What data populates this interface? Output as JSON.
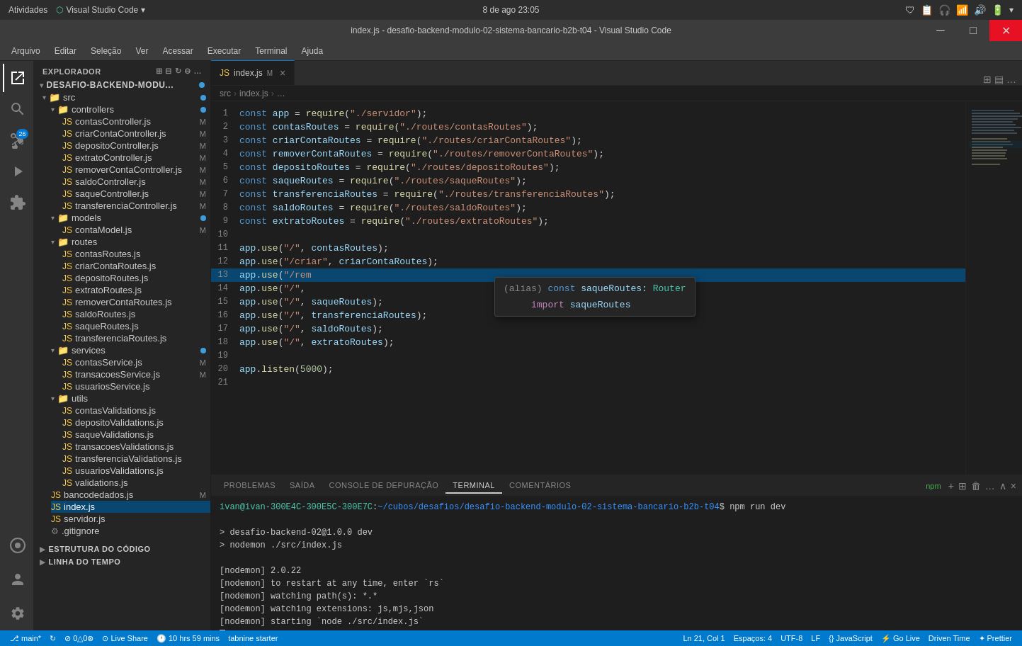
{
  "system_bar": {
    "left_items": [
      "Atividades"
    ],
    "app_title": "Visual Studio Code",
    "datetime": "8 de ago  23:05",
    "icons": [
      "network",
      "sound",
      "battery",
      "settings"
    ]
  },
  "title_bar": {
    "title": "index.js - desafio-backend-modulo-02-sistema-bancario-b2b-t04 - Visual Studio Code",
    "controls": [
      "minimize",
      "maximize",
      "close"
    ]
  },
  "menu_bar": {
    "items": [
      "Arquivo",
      "Editar",
      "Seleção",
      "Ver",
      "Acessar",
      "Executar",
      "Terminal",
      "Ajuda"
    ]
  },
  "activity_bar": {
    "icons": [
      {
        "name": "explorer-icon",
        "symbol": "⬚",
        "active": true
      },
      {
        "name": "search-icon",
        "symbol": "🔍",
        "active": false
      },
      {
        "name": "source-control-icon",
        "symbol": "⎇",
        "active": false,
        "badge": "26"
      },
      {
        "name": "run-debug-icon",
        "symbol": "▷",
        "active": false
      },
      {
        "name": "extensions-icon",
        "symbol": "⊞",
        "active": false
      },
      {
        "name": "remote-icon",
        "symbol": "⊙",
        "active": false
      },
      {
        "name": "accounts-icon",
        "symbol": "👤",
        "active": false
      },
      {
        "name": "settings-icon",
        "symbol": "⚙",
        "active": false
      }
    ]
  },
  "explorer": {
    "title": "EXPLORADOR",
    "project": "DESAFIO-BACKEND-MODU...",
    "tree": {
      "src": {
        "controllers": {
          "files": [
            {
              "name": "contasController.js",
              "modified": "M"
            },
            {
              "name": "criarContaController.js",
              "modified": "M"
            },
            {
              "name": "depositoController.js",
              "modified": "M"
            },
            {
              "name": "extratoController.js",
              "modified": "M"
            },
            {
              "name": "removerContaController.js",
              "modified": "M"
            },
            {
              "name": "saldoController.js",
              "modified": "M"
            },
            {
              "name": "saqueController.js",
              "modified": "M"
            },
            {
              "name": "transferenciaController.js",
              "modified": "M"
            }
          ]
        },
        "models": {
          "files": [
            {
              "name": "contaModel.js",
              "modified": "M"
            }
          ]
        },
        "routes": {
          "files": [
            {
              "name": "contasRoutes.js",
              "modified": ""
            },
            {
              "name": "criarContaRoutes.js",
              "modified": ""
            },
            {
              "name": "depositoRoutes.js",
              "modified": ""
            },
            {
              "name": "extratoRoutes.js",
              "modified": ""
            },
            {
              "name": "removerContaRoutes.js",
              "modified": ""
            },
            {
              "name": "saldoRoutes.js",
              "modified": ""
            },
            {
              "name": "saqueRoutes.js",
              "modified": ""
            },
            {
              "name": "transferenciaRoutes.js",
              "modified": ""
            }
          ]
        },
        "services": {
          "files": [
            {
              "name": "contasService.js",
              "modified": "M"
            },
            {
              "name": "transacoesService.js",
              "modified": "M"
            },
            {
              "name": "usuariosService.js",
              "modified": ""
            }
          ]
        },
        "utils": {
          "files": [
            {
              "name": "contasValidations.js",
              "modified": ""
            },
            {
              "name": "depositoValidations.js",
              "modified": ""
            },
            {
              "name": "saqueValidations.js",
              "modified": ""
            },
            {
              "name": "transacoesValidations.js",
              "modified": ""
            },
            {
              "name": "transferenciaValidations.js",
              "modified": ""
            },
            {
              "name": "usuariosValidations.js",
              "modified": ""
            },
            {
              "name": "validations.js",
              "modified": ""
            }
          ]
        },
        "root_files": [
          {
            "name": "bancodedados.js",
            "modified": "M"
          },
          {
            "name": "index.js",
            "modified": ""
          },
          {
            "name": "servidor.js",
            "modified": ""
          },
          {
            "name": ".gitignore",
            "modified": ""
          }
        ]
      }
    }
  },
  "editor": {
    "tab": {
      "filename": "index.js",
      "modified": "M",
      "close_symbol": "×"
    },
    "breadcrumb": [
      "src",
      ">",
      "index.js",
      ">",
      "..."
    ],
    "lines": [
      {
        "num": 1,
        "content": "const app = require(\"./servidor\");"
      },
      {
        "num": 2,
        "content": "const contasRoutes = require(\"./routes/contasRoutes\");"
      },
      {
        "num": 3,
        "content": "const criarContaRoutes = require(\"./routes/criarContaRoutes\");"
      },
      {
        "num": 4,
        "content": "const removerContaRoutes = require(\"./routes/removerContaRoutes\");"
      },
      {
        "num": 5,
        "content": "const depositoRoutes = require(\"./routes/depositoRoutes\");"
      },
      {
        "num": 6,
        "content": "const saqueRoutes = require(\"./routes/saqueRoutes\");"
      },
      {
        "num": 7,
        "content": "const transferenciaRoutes = require(\"./routes/transferenciaRoutes\");"
      },
      {
        "num": 8,
        "content": "const saldoRoutes = require(\"./routes/saldoRoutes\");"
      },
      {
        "num": 9,
        "content": "const extratoRoutes = require(\"./routes/extratoRoutes\");"
      },
      {
        "num": 10,
        "content": ""
      },
      {
        "num": 11,
        "content": "app.use(\"/\", contasRoutes);"
      },
      {
        "num": 12,
        "content": "app.use(\"/criar\", criarContaRoutes);"
      },
      {
        "num": 13,
        "content": "app.use(\"/rem"
      },
      {
        "num": 14,
        "content": "app.use(\"/\","
      },
      {
        "num": 15,
        "content": "app.use(\"/\", saqueRoutes);"
      },
      {
        "num": 16,
        "content": "app.use(\"/\", transferenciaRoutes);"
      },
      {
        "num": 17,
        "content": "app.use(\"/\", saldoRoutes);"
      },
      {
        "num": 18,
        "content": "app.use(\"/\", extratoRoutes);"
      },
      {
        "num": 19,
        "content": ""
      },
      {
        "num": 20,
        "content": "app.listen(5000);"
      },
      {
        "num": 21,
        "content": ""
      }
    ],
    "autocomplete": {
      "line1": "(alias) const saqueRoutes: Router",
      "line2": "import saqueRoutes"
    }
  },
  "panel": {
    "tabs": [
      "PROBLEMAS",
      "SAÍDA",
      "CONSOLE DE DEPURAÇÃO",
      "TERMINAL",
      "COMENTÁRIOS"
    ],
    "active_tab": "TERMINAL",
    "npm_label": "npm",
    "terminal_content": [
      {
        "type": "prompt",
        "text": "ivan@ivan-300E4C-300E5C-300E7C:~/cubos/desafios/desafio-backend-modulo-02-sistema-bancario-b2b-t04$",
        "cmd": " npm run dev"
      },
      {
        "type": "output",
        "text": ""
      },
      {
        "type": "output",
        "text": "> desafio-backend-02@1.0.0 dev"
      },
      {
        "type": "output",
        "text": "> nodemon ./src/index.js"
      },
      {
        "type": "output",
        "text": ""
      },
      {
        "type": "output",
        "text": "[nodemon] 2.0.22"
      },
      {
        "type": "output",
        "text": "[nodemon] to restart at any time, enter `rs`"
      },
      {
        "type": "output",
        "text": "[nodemon] watching path(s): *.*"
      },
      {
        "type": "output",
        "text": "[nodemon] watching extensions: js,mjs,json"
      },
      {
        "type": "output",
        "text": "[nodemon] starting `node ./src/index.js`"
      },
      {
        "type": "cursor",
        "text": ""
      }
    ]
  },
  "status_bar": {
    "left_items": [
      {
        "icon": "⎇",
        "text": "main*"
      },
      {
        "icon": "↻",
        "text": ""
      },
      {
        "icon": "⊘",
        "text": "0△0⊗"
      },
      {
        "icon": "↓↑",
        "text": ""
      }
    ],
    "live_share": "Live Share",
    "live_share_icon": "⊙",
    "right_items": [
      {
        "text": "Ln 21, Col 1"
      },
      {
        "text": "Espaços: 4"
      },
      {
        "text": "UTF-8"
      },
      {
        "text": "LF"
      },
      {
        "text": "{} JavaScript"
      },
      {
        "text": "⚡ Go Live"
      },
      {
        "text": "Driven Time"
      },
      {
        "text": "✦ Prettier"
      }
    ],
    "time_running": "10 hrs 59 mins",
    "tabnine": "tabnine starter"
  },
  "sidebar_structure": {
    "structure_label": "ESTRUTURA DO CÓDIGO",
    "timeline_label": "LINHA DO TEMPO"
  }
}
